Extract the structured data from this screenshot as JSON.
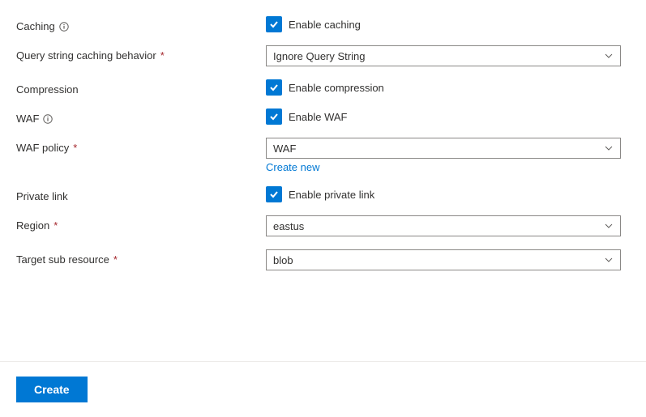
{
  "fields": {
    "caching": {
      "label": "Caching",
      "checkLabel": "Enable caching"
    },
    "queryString": {
      "label": "Query string caching behavior",
      "value": "Ignore Query String"
    },
    "compression": {
      "label": "Compression",
      "checkLabel": "Enable compression"
    },
    "waf": {
      "label": "WAF",
      "checkLabel": "Enable WAF"
    },
    "wafPolicy": {
      "label": "WAF policy",
      "value": "WAF",
      "createNew": "Create new"
    },
    "privateLink": {
      "label": "Private link",
      "checkLabel": "Enable private link"
    },
    "region": {
      "label": "Region",
      "value": "eastus"
    },
    "targetSub": {
      "label": "Target sub resource",
      "value": "blob"
    }
  },
  "footer": {
    "create": "Create"
  }
}
